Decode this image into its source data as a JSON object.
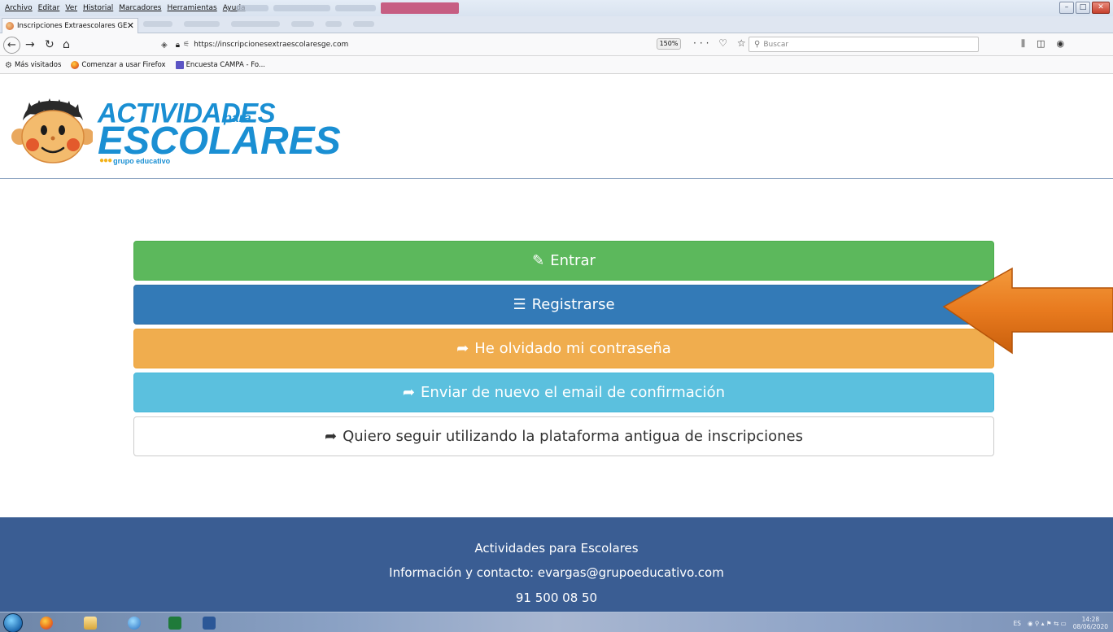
{
  "browser": {
    "menu_items": [
      "Archivo",
      "Editar",
      "Ver",
      "Historial",
      "Marcadores",
      "Herramientas",
      "Ayuda"
    ],
    "tab_title": "Inscripciones Extraescolares GE",
    "tab_close": "✕",
    "url": "https://inscripcionesextraescolaresge.com",
    "zoom": "150%",
    "page_actions": "··· ♡ ☆",
    "search_placeholder": "Buscar",
    "bookmarks": [
      "Más visitados",
      "Comenzar a usar Firefox",
      "Encuesta CAMPA - Fo..."
    ]
  },
  "logo": {
    "line1": "ACTIVIDADES",
    "line1_suffix": "para",
    "line2": "ESCOLARES",
    "tagline": "grupo educativo"
  },
  "actions": [
    {
      "label": "Entrar",
      "icon": "pencil-icon",
      "glyph": "✎",
      "color": "#5cb85c"
    },
    {
      "label": "Registrarse",
      "icon": "list-icon",
      "glyph": "☰",
      "color": "#337ab7"
    },
    {
      "label": "He olvidado mi contraseña",
      "icon": "share-arrow-icon",
      "glyph": "➦",
      "color": "#f0ad4e"
    },
    {
      "label": "Enviar de nuevo el email de confirmación",
      "icon": "share-arrow-icon",
      "glyph": "➦",
      "color": "#5bc0de"
    },
    {
      "label": "Quiero seguir utilizando la plataforma antigua de inscripciones",
      "icon": "share-arrow-icon",
      "glyph": "➦",
      "color": "#ffffff"
    }
  ],
  "annotation": {
    "color": "#e87a1e"
  },
  "footer": {
    "line1": "Actividades para Escolares",
    "line2": "Información y contacto: evargas@grupoeducativo.com",
    "line3": "91 500 08 50"
  },
  "taskbar": {
    "tray_lang": "ES",
    "time": "14:28",
    "date": "08/06/2020"
  }
}
